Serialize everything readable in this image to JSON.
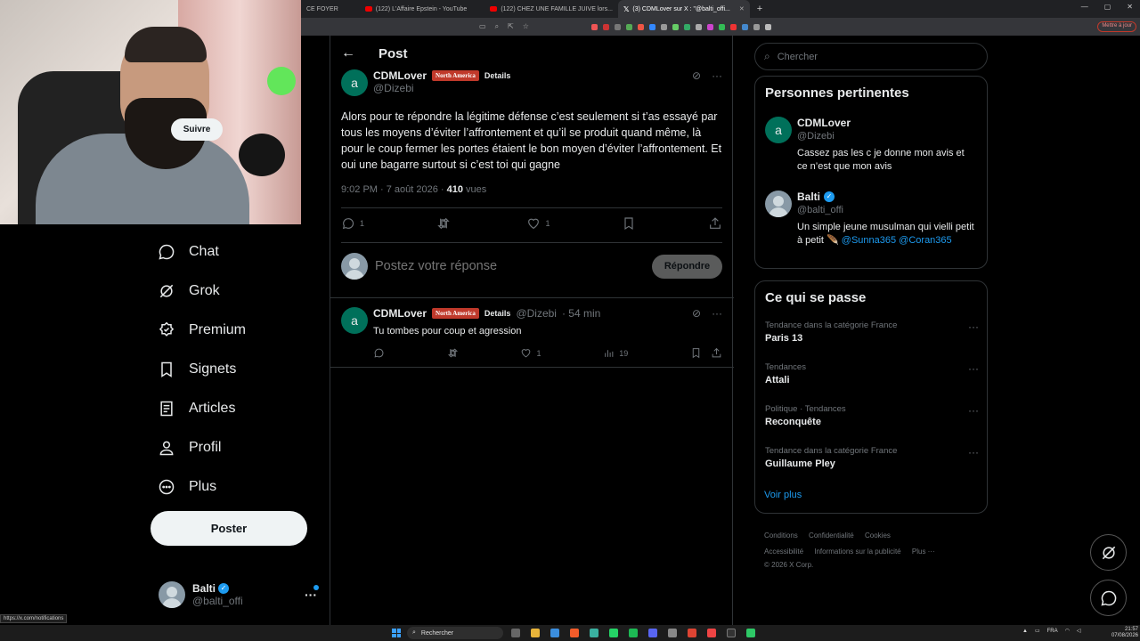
{
  "browser": {
    "tabs": [
      {
        "label": "CE FOYER",
        "kind": "partial"
      },
      {
        "label": "(122) L'Affaire Epstein - YouTube",
        "kind": "youtube"
      },
      {
        "label": "(122) CHEZ UNE FAMILLE JUIVE lors...",
        "kind": "youtube"
      },
      {
        "label": "(3) CDMLover sur X : \"@balti_offi...",
        "kind": "x",
        "active": true
      }
    ],
    "update_button": "Mettre à jour"
  },
  "nav": {
    "items": [
      {
        "label": "Chat",
        "icon": "chat-icon"
      },
      {
        "label": "Grok",
        "icon": "grok-icon"
      },
      {
        "label": "Premium",
        "icon": "premium-icon"
      },
      {
        "label": "Signets",
        "icon": "bookmark-icon"
      },
      {
        "label": "Articles",
        "icon": "articles-icon"
      },
      {
        "label": "Profil",
        "icon": "profile-icon"
      },
      {
        "label": "Plus",
        "icon": "more-circle-icon"
      }
    ],
    "post_button": "Poster",
    "account": {
      "name": "Balti",
      "handle": "@balti_offi",
      "more": "···"
    }
  },
  "status_url": "https://x.com/notifications",
  "post": {
    "header_title": "Post",
    "author": {
      "name": "CDMLover",
      "badge": "North America",
      "details": "Details",
      "handle": "@Dizebi",
      "avatar_letter": "a"
    },
    "text": "Alors pour te répondre la légitime défense c’est seulement si t’as essayé par tous les moyens d’éviter l’affrontement et qu’il se produit quand même, là pour le coup fermer les portes étaient le bon moyen d’éviter l’affrontement. Et oui une bagarre surtout si c’est toi qui gagne",
    "time": "9:02 PM · 7 août 2026 · ",
    "views": "410",
    "views_label": " vues",
    "replies": "1",
    "reposts": "",
    "likes": "1"
  },
  "reply_box": {
    "placeholder": "Postez votre réponse",
    "button": "Répondre"
  },
  "reply": {
    "author": "CDMLover",
    "badge": "North America",
    "details": "Details",
    "handle": "@Dizebi",
    "time": "· 54 min",
    "text": "Tu tombes pour coup et agression",
    "avatar_letter": "a",
    "likes": "1",
    "views": "19"
  },
  "search": {
    "placeholder": "Chercher"
  },
  "people": {
    "title": "Personnes pertinentes",
    "list": [
      {
        "name": "CDMLover",
        "handle": "@Dizebi",
        "bio": "Cassez pas les c je donne mon avis et ce n’est que mon avis",
        "follow": "Suivre",
        "avatar_letter": "a"
      },
      {
        "name": "Balti",
        "handle": "@balti_offi",
        "bio": "Un simple jeune musulman qui vielli petit à petit 🪶 ",
        "links": [
          "@Sunna365",
          "@Coran365"
        ]
      }
    ]
  },
  "trends": {
    "title": "Ce qui se passe",
    "items": [
      {
        "category": "Tendance dans la catégorie France",
        "name": "Paris 13"
      },
      {
        "category": "Tendances",
        "name": "Attali"
      },
      {
        "category": "Politique · Tendances",
        "name": "Reconquête"
      },
      {
        "category": "Tendance dans la catégorie France",
        "name": "Guillaume Pley"
      }
    ],
    "more": "Voir plus"
  },
  "footer": {
    "links": [
      "Conditions",
      "Confidentialité",
      "Cookies",
      "Accessibilité",
      "Informations sur la publicité",
      "Plus ···"
    ],
    "copyright": "© 2026 X Corp."
  },
  "taskbar": {
    "search_label": "Rechercher",
    "lang": "FRA",
    "time": "21:57",
    "date": "07/08/2026"
  }
}
